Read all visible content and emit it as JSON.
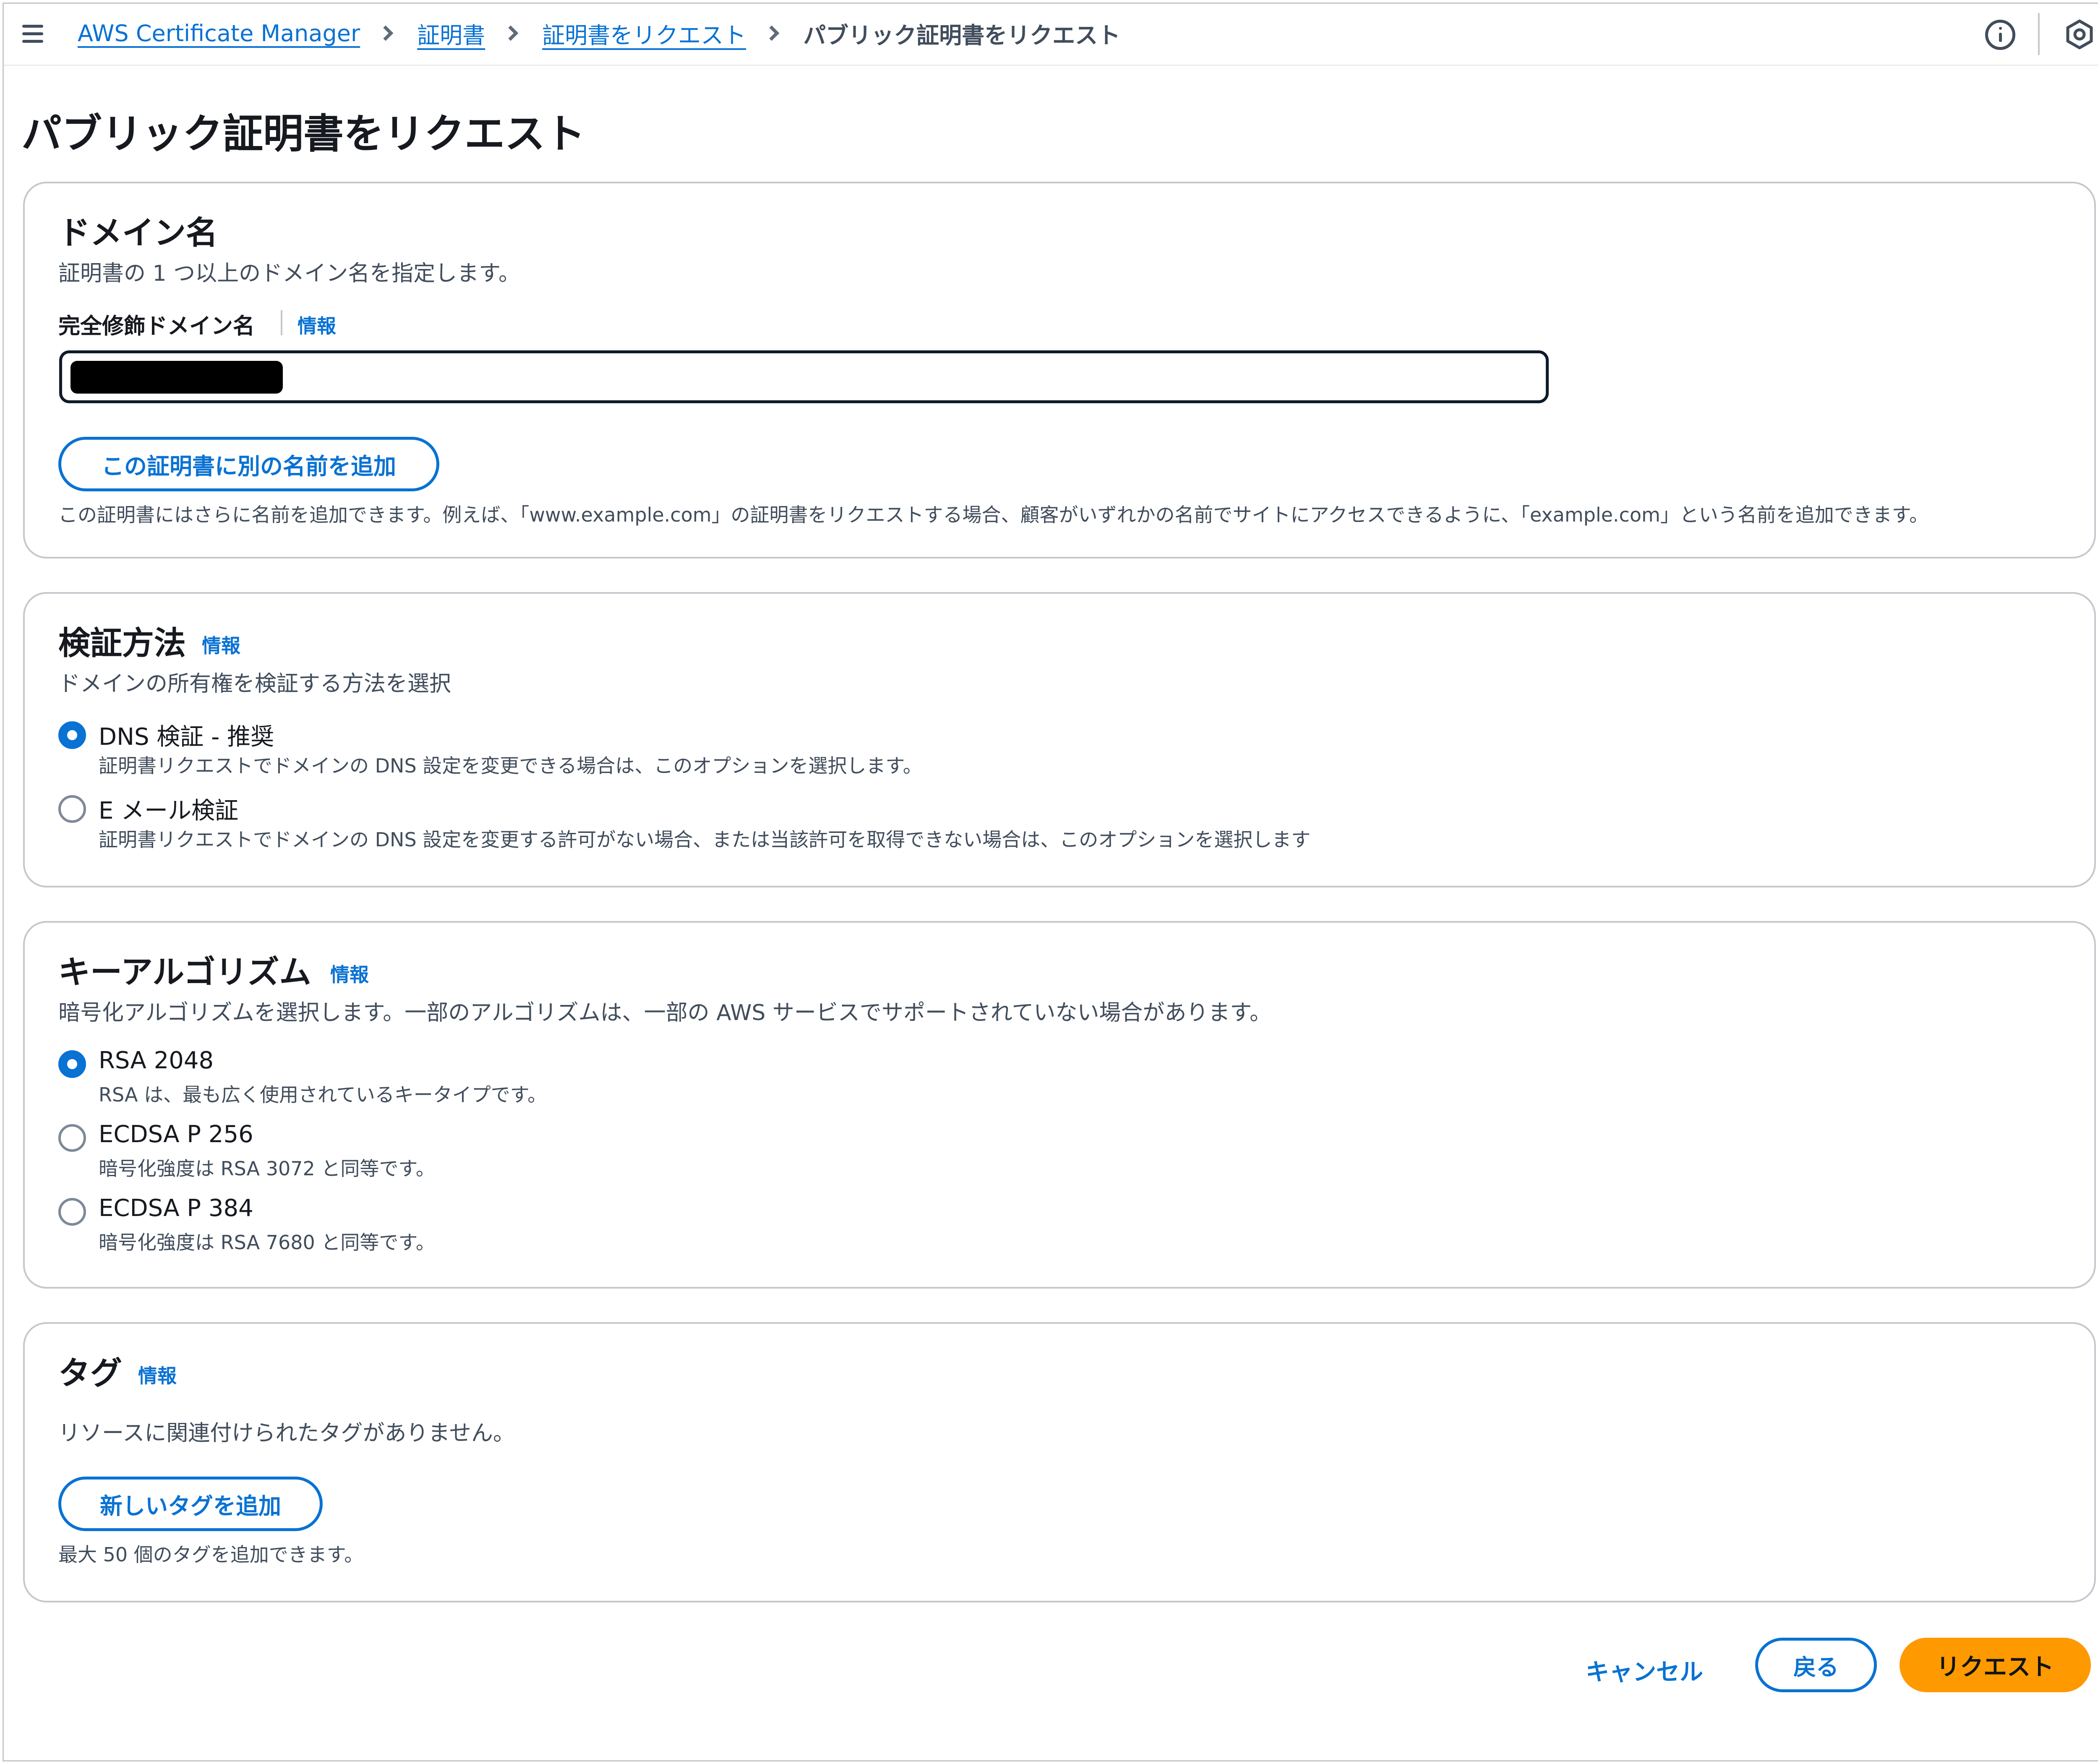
{
  "header": {
    "breadcrumbs": [
      {
        "label": "AWS Certificate Manager"
      },
      {
        "label": "証明書"
      },
      {
        "label": "証明書をリクエスト"
      }
    ],
    "current": "パブリック証明書をリクエスト",
    "icons": {
      "menu": "menu-icon",
      "info": "info-circle-icon",
      "settings": "hexagon-settings-icon"
    }
  },
  "page": {
    "title": "パブリック証明書をリクエスト"
  },
  "domain_section": {
    "title": "ドメイン名",
    "description": "証明書の 1 つ以上のドメイン名を指定します。",
    "field_label": "完全修飾ドメイン名",
    "info": "情報",
    "field_value": "[redacted]",
    "add_name_button": "この証明書に別の名前を追加",
    "hint": "この証明書にはさらに名前を追加できます。例えば、「www.example.com」の証明書をリクエストする場合、顧客がいずれかの名前でサイトにアクセスできるように、「example.com」という名前を追加できます。"
  },
  "validation_section": {
    "title": "検証方法",
    "info": "情報",
    "description": "ドメインの所有権を検証する方法を選択",
    "options": [
      {
        "label": "DNS 検証 - 推奨",
        "description": "証明書リクエストでドメインの DNS 設定を変更できる場合は、このオプションを選択します。",
        "selected": true
      },
      {
        "label": "E メール検証",
        "description": "証明書リクエストでドメインの DNS 設定を変更する許可がない場合、または当該許可を取得できない場合は、このオプションを選択します",
        "selected": false
      }
    ]
  },
  "key_section": {
    "title": "キーアルゴリズム",
    "info": "情報",
    "description": "暗号化アルゴリズムを選択します。一部のアルゴリズムは、一部の AWS サービスでサポートされていない場合があります。",
    "options": [
      {
        "label": "RSA 2048",
        "description": "RSA は、最も広く使用されているキータイプです。",
        "selected": true
      },
      {
        "label": "ECDSA P 256",
        "description": "暗号化強度は RSA 3072 と同等です。",
        "selected": false
      },
      {
        "label": "ECDSA P 384",
        "description": "暗号化強度は RSA 7680 と同等です。",
        "selected": false
      }
    ]
  },
  "tags_section": {
    "title": "タグ",
    "info": "情報",
    "empty_text": "リソースに関連付けられたタグがありません。",
    "add_button": "新しいタグを追加",
    "limit_text": "最大 50 個のタグを追加できます。"
  },
  "actions": {
    "cancel": "キャンセル",
    "back": "戻る",
    "submit": "リクエスト"
  },
  "colors": {
    "link": "#0972d3",
    "primary": "#ff9900",
    "border": "#c6c6cd",
    "text": "#16191f"
  }
}
